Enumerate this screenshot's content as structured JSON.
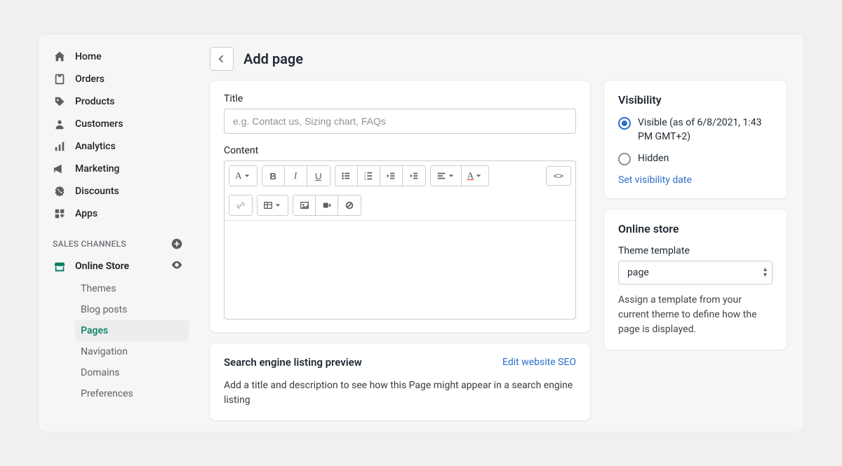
{
  "sidebar": {
    "items": [
      {
        "label": "Home"
      },
      {
        "label": "Orders"
      },
      {
        "label": "Products"
      },
      {
        "label": "Customers"
      },
      {
        "label": "Analytics"
      },
      {
        "label": "Marketing"
      },
      {
        "label": "Discounts"
      },
      {
        "label": "Apps"
      }
    ],
    "section_label": "SALES CHANNELS",
    "online_store": {
      "label": "Online Store"
    },
    "sub_items": [
      {
        "label": "Themes"
      },
      {
        "label": "Blog posts"
      },
      {
        "label": "Pages",
        "active": true
      },
      {
        "label": "Navigation"
      },
      {
        "label": "Domains"
      },
      {
        "label": "Preferences"
      }
    ]
  },
  "header": {
    "title": "Add page"
  },
  "title_field": {
    "label": "Title",
    "placeholder": "e.g. Contact us, Sizing chart, FAQs",
    "value": ""
  },
  "content_field": {
    "label": "Content"
  },
  "seo": {
    "title": "Search engine listing preview",
    "edit_link": "Edit website SEO",
    "description": "Add a title and description to see how this Page might appear in a search engine listing"
  },
  "visibility": {
    "title": "Visibility",
    "options": [
      {
        "label": "Visible (as of 6/8/2021, 1:43 PM GMT+2)",
        "checked": true
      },
      {
        "label": "Hidden",
        "checked": false
      }
    ],
    "set_date_link": "Set visibility date"
  },
  "online_store_card": {
    "title": "Online store",
    "template_label": "Theme template",
    "template_value": "page",
    "helper": "Assign a template from your current theme to define how the page is displayed."
  }
}
